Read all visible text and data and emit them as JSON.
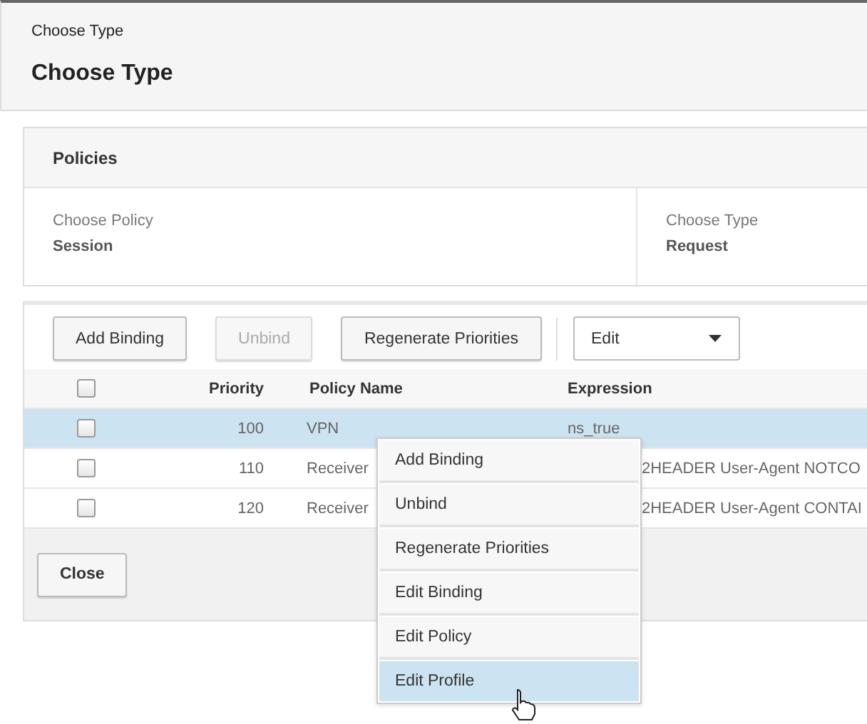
{
  "breadcrumb": "Choose Type",
  "title": "Choose Type",
  "policies": {
    "heading": "Policies",
    "fields": [
      {
        "label": "Choose Policy",
        "value": "Session"
      },
      {
        "label": "Choose Type",
        "value": "Request"
      }
    ]
  },
  "toolbar": {
    "buttons": [
      {
        "label": "Add Binding",
        "disabled": false
      },
      {
        "label": "Unbind",
        "disabled": true
      },
      {
        "label": "Regenerate Priorities",
        "disabled": false
      }
    ],
    "dropdown": "Edit"
  },
  "table": {
    "columns": [
      "Priority",
      "Policy Name",
      "Expression"
    ],
    "header_checked": false,
    "rows": [
      {
        "checked": false,
        "selected": true,
        "priority": "100",
        "policy_name": "VPN",
        "expression": "ns_true"
      },
      {
        "checked": false,
        "selected": false,
        "priority": "110",
        "policy_name": "Receiver",
        "expression": "2HEADER User-Agent NOTCO"
      },
      {
        "checked": false,
        "selected": false,
        "priority": "120",
        "policy_name": "Receiver",
        "expression": "2HEADER User-Agent CONTAI"
      }
    ]
  },
  "close_button": "Close",
  "context_menu": [
    {
      "label": "Add Binding",
      "selected": false
    },
    {
      "label": "Unbind",
      "selected": false
    },
    {
      "label": "Regenerate Priorities",
      "selected": false
    },
    {
      "label": "Edit Binding",
      "selected": false
    },
    {
      "label": "Edit Policy",
      "selected": false
    },
    {
      "label": "Edit Profile",
      "selected": true
    }
  ]
}
